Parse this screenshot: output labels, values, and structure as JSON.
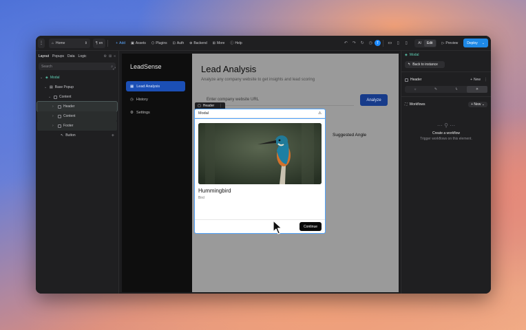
{
  "toolbar": {
    "page_select": "Home",
    "lang": "en",
    "add": "Add",
    "assets": "Assets",
    "plugins": "Plugins",
    "auth": "Auth",
    "backend": "Backend",
    "more": "More",
    "help": "Help",
    "avatar_letter": "T",
    "mode_ai": "AI",
    "mode_edit": "Edit",
    "preview": "Preview",
    "deploy": "Deploy"
  },
  "left": {
    "tabs": [
      "Layout",
      "Popups",
      "Data",
      "Logic"
    ],
    "search_placeholder": "Search",
    "tree": [
      {
        "label": "Modal"
      },
      {
        "label": "Base Popup"
      },
      {
        "label": "Content"
      },
      {
        "label": "Header"
      },
      {
        "label": "Content"
      },
      {
        "label": "Footer"
      },
      {
        "label": "Button"
      }
    ]
  },
  "app": {
    "brand": "LeadSense",
    "nav": [
      "Lead Analysis",
      "History",
      "Settings"
    ],
    "title": "Lead Analysis",
    "subtitle": "Analyze any company website to get insights and lead scoring",
    "url_placeholder": "Enter company website URL",
    "analyze": "Analyze",
    "suggested": "Suggested Angle"
  },
  "modal": {
    "tag": "Header",
    "title": "Modal",
    "card_title": "Hummingbird",
    "card_sub": "Bird",
    "continue": "Continue"
  },
  "right": {
    "component": "Modal",
    "back": "Back to instance",
    "section_header": "Header",
    "new": "New",
    "workflows": "Workflows",
    "wf_new": "New",
    "wf_empty_title": "Create a workflow",
    "wf_empty_sub": "Trigger workflows on this element."
  },
  "colors": {
    "accent": "#1e88e5",
    "nav_active": "#1b4fb5",
    "selection": "#4fa3ff"
  }
}
